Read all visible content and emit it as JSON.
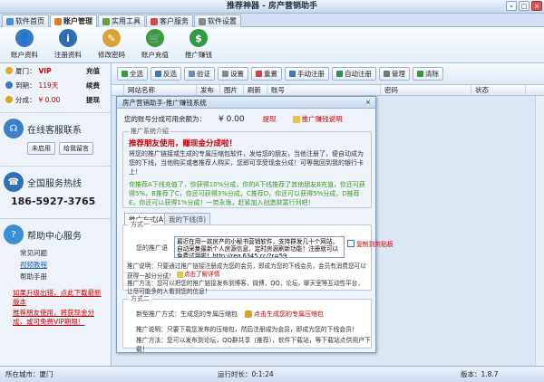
{
  "window": {
    "title": "推荐神器 - 房产营销助手"
  },
  "tabs": [
    {
      "label": "软件首页"
    },
    {
      "label": "账户管理"
    },
    {
      "label": "实用工具"
    },
    {
      "label": "客户服务"
    },
    {
      "label": "软件设置"
    }
  ],
  "ribbon": [
    {
      "label": "账户资料"
    },
    {
      "label": "注册资料"
    },
    {
      "label": "修改密码"
    },
    {
      "label": "账户充值"
    },
    {
      "label": "推广赚钱"
    }
  ],
  "user": {
    "city_label": "厦门：",
    "vip": "VIP",
    "recharge": "充值",
    "expire_label": "到期：",
    "days": "119天",
    "renew": "续费",
    "points_label": "分成：",
    "points": "¥ 0.00",
    "withdraw": "提现"
  },
  "service": {
    "title": "在线客服联系",
    "not_enabled": "未启用",
    "message": "给我留言",
    "hotline_title": "全国服务热线",
    "phone": "186-5927-3765"
  },
  "help": {
    "title": "帮助中心服务",
    "items": [
      "常见问题",
      "视频教程",
      "帮助手册"
    ]
  },
  "promos": [
    "如果升级出错，点此下载最新版本",
    "推荐朋友使用，将获现金分成，或可免费VIP期限！"
  ],
  "toolbar": [
    "全选",
    "反选",
    "验证",
    "设置",
    "重置",
    "手动注册",
    "自动注册",
    "管理",
    "清除"
  ],
  "grid_headers": [
    "网站名称",
    "发布",
    "图片",
    "刷新",
    "账号",
    "密码",
    "状态"
  ],
  "dialog": {
    "title": "房产营销助手-推广赚钱系统",
    "balance_label": "您的账号分成可用余额为：",
    "balance": "¥ 0.00",
    "withdraw": "提现",
    "explain": "推广赚钱说明",
    "intro_legend": "推广系统介绍",
    "headline": "推荐朋友使用，赚现金分成啦！",
    "desc": "将您的推广链接或生成的专属压缩包软件，发给您的朋友，当他注册了，便自动成为您的下线，当他购买或者推荐人购买，您即可享受现金分成！可等我回到我的银行卡上！",
    "green": "你推荐A下线充值了，你获得10%分成，你的A下线推荐了其他朋友B充值，你还可获得5%，B推荐了C，你还可获得3%分成，C推荐D，你还可以获得5%分成，D推荐E，你还可以获得1%分成！一劳永逸，赶紧加入创造财富行列吧！",
    "subtabs": [
      "推广方式(A)",
      "我的下线(B)"
    ],
    "m1_legend": "方式一",
    "m1_link_label": "您的推广语",
    "m1_link_text": "最近在用一款房产的小秘书营销软件，支持群发几十个网站，自动采集最新个人房源信息，定时房源刷新功能！注册就可以免费试用啦！http://reg.6345.cc/?r=59",
    "copy": "复制到剪贴板",
    "m1_desc": "推广说明：只要通过推广链接注册成为您的会员，即成为您的下线会员，会员有消费您可以获得一部分分成！",
    "detail": "点击了解详情",
    "m1_method": "推广方法：您可以把您的推广链接发布到博客，微博，QQ，论坛，聊天室等互动性平台，让尽可能多的人看到您的信息！",
    "m2_legend": "方式二",
    "m2_label": "新型推广方式：生成您的专属压缩包",
    "m2_btn": "点击生成您的专属压缩包",
    "m2_desc": "推广说明：只要下载您发布的压缩包，然后注册成为会员，即成为您的下线会员！",
    "m2_method": "推广方法：您可以发布到论坛，QQ群共享（推荐），软件下载站，等下载站点供用户下载！"
  },
  "status": {
    "city": "所在城市：厦门",
    "runtime": "运行时长：0:1:24",
    "version": "版本：1.8.7"
  }
}
